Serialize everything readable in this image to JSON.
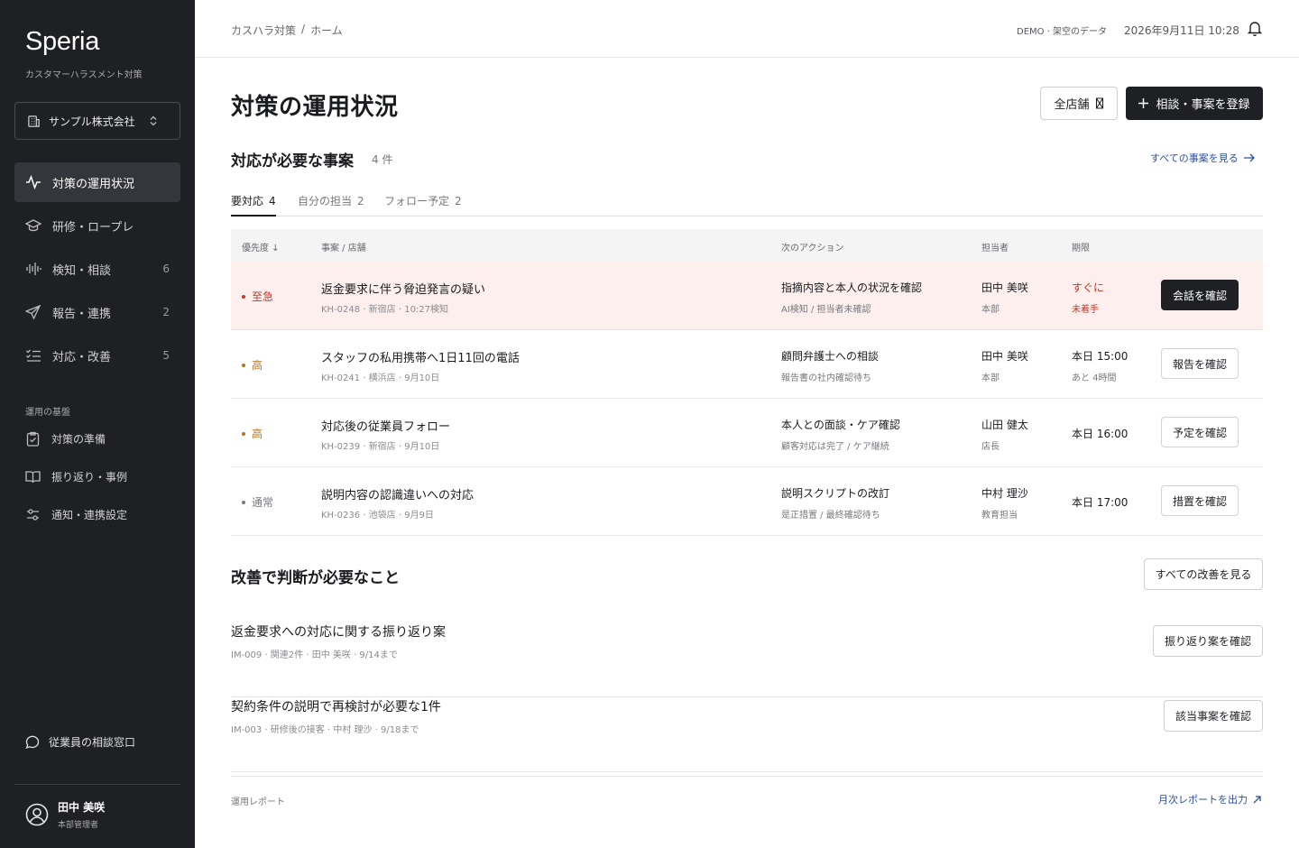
{
  "sidebar": {
    "brand": "Speria",
    "brand_sub": "カスタマーハラスメント対策",
    "org": "サンプル株式会社",
    "nav": [
      {
        "label": "対策の運用状況",
        "count": "",
        "icon": "activity-icon"
      },
      {
        "label": "研修・ロープレ",
        "count": "",
        "icon": "graduation-cap-icon"
      },
      {
        "label": "検知・相談",
        "count": "6",
        "icon": "audio-wave-icon"
      },
      {
        "label": "報告・連携",
        "count": "2",
        "icon": "send-icon"
      },
      {
        "label": "対応・改善",
        "count": "5",
        "icon": "checklist-icon"
      }
    ],
    "section_label": "運用の基盤",
    "sub_items": [
      {
        "label": "対策の準備",
        "icon": "clipboard-check-icon"
      },
      {
        "label": "振り返り・事例",
        "icon": "book-open-icon"
      },
      {
        "label": "通知・連携設定",
        "icon": "sliders-icon"
      }
    ],
    "consult": "従業員の相談窓口",
    "user": {
      "name": "田中 美咲",
      "role": "本部管理者"
    }
  },
  "topbar": {
    "breadcrumb": [
      "カスハラ対策",
      "/",
      "ホーム"
    ],
    "demo": "DEMO · 架空のデータ",
    "datetime": "2026年9月11日 10:28"
  },
  "main": {
    "title": "対策の運用状況",
    "store_filter": "全店舗",
    "register_button": "相談・事案を登録",
    "cases_section": {
      "title": "対応が必要な事案",
      "count": "4 件",
      "view_all": "すべての事案を見る"
    },
    "tabs": [
      {
        "label": "要対応",
        "count": "4"
      },
      {
        "label": "自分の担当",
        "count": "2"
      },
      {
        "label": "フォロー予定",
        "count": "2"
      }
    ],
    "table": {
      "headers": {
        "priority": "優先度 ↓",
        "case": "事案 / 店舗",
        "action": "次のアクション",
        "owner": "担当者",
        "due": "期限"
      },
      "rows": [
        {
          "priority": "至急",
          "priority_color": "#c0392b",
          "title": "返金要求に伴う脅迫発言の疑い",
          "meta": "KH-0248 · 新宿店 · 10:27検知",
          "action": "指摘内容と本人の状況を確認",
          "action_sub": "AI検知 / 担当者未確認",
          "owner": "田中 美咲",
          "owner_sub": "本部",
          "due": "すぐに",
          "due_sub": "未着手",
          "button": "会話を確認"
        },
        {
          "priority": "高",
          "priority_color": "#b8731e",
          "title": "スタッフの私用携帯へ1日11回の電話",
          "meta": "KH-0241 · 横浜店 · 9月10日",
          "action": "顧問弁護士への相談",
          "action_sub": "報告書の社内確認待ち",
          "owner": "田中 美咲",
          "owner_sub": "本部",
          "due": "本日 15:00",
          "due_sub": "あと 4時間",
          "button": "報告を確認"
        },
        {
          "priority": "高",
          "priority_color": "#b8731e",
          "title": "対応後の従業員フォロー",
          "meta": "KH-0239 · 新宿店 · 9月10日",
          "action": "本人との面談・ケア確認",
          "action_sub": "顧客対応は完了 / ケア継続",
          "owner": "山田 健太",
          "owner_sub": "店長",
          "due": "本日 16:00",
          "due_sub": "",
          "button": "予定を確認"
        },
        {
          "priority": "通常",
          "priority_color": "#77787d",
          "title": "説明内容の認識違いへの対応",
          "meta": "KH-0236 · 池袋店 · 9月9日",
          "action": "説明スクリプトの改訂",
          "action_sub": "是正措置 / 最終確認待ち",
          "owner": "中村 理沙",
          "owner_sub": "教育担当",
          "due": "本日 17:00",
          "due_sub": "",
          "button": "措置を確認"
        }
      ]
    },
    "improvements": {
      "title": "改善で判断が必要なこと",
      "view_all": "すべての改善を見る",
      "items": [
        {
          "title": "返金要求への対応に関する振り返り案",
          "meta": "IM-009 · 関連2件 · 田中 美咲 · 9/14まで",
          "button": "振り返り案を確認"
        },
        {
          "title": "契約条件の説明で再検討が必要な1件",
          "meta": "IM-003 · 研修後の接客 · 中村 理沙 · 9/18まで",
          "button": "該当事案を確認"
        }
      ]
    },
    "footer": {
      "label": "運用レポート",
      "export": "月次レポートを出力"
    }
  }
}
